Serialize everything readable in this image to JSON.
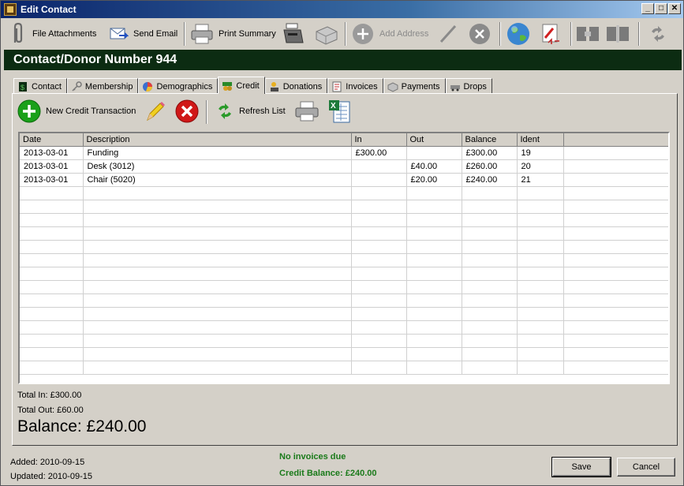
{
  "window": {
    "title": "Edit Contact"
  },
  "toolbar": {
    "file_attachments": "File Attachments",
    "send_email": "Send Email",
    "print_summary": "Print Summary",
    "add_address": "Add Address"
  },
  "banner": {
    "title": "Contact/Donor Number 944"
  },
  "tabs": [
    {
      "label": "Contact",
      "icon": "contact-icon"
    },
    {
      "label": "Membership",
      "icon": "key-icon"
    },
    {
      "label": "Demographics",
      "icon": "pie-chart-icon"
    },
    {
      "label": "Credit",
      "icon": "credit-icon",
      "active": true
    },
    {
      "label": "Donations",
      "icon": "donations-icon"
    },
    {
      "label": "Invoices",
      "icon": "invoice-icon"
    },
    {
      "label": "Payments",
      "icon": "payments-icon"
    },
    {
      "label": "Drops",
      "icon": "drops-icon"
    }
  ],
  "credit_toolbar": {
    "new_transaction": "New Credit Transaction",
    "refresh": "Refresh List"
  },
  "grid": {
    "columns": [
      "Date",
      "Description",
      "In",
      "Out",
      "Balance",
      "Ident"
    ],
    "rows": [
      [
        "2013-03-01",
        "Funding",
        "£300.00",
        "",
        "£300.00",
        "19"
      ],
      [
        "2013-03-01",
        "Desk (3012)",
        "",
        "£40.00",
        "£260.00",
        "20"
      ],
      [
        "2013-03-01",
        "Chair (5020)",
        "",
        "£20.00",
        "£240.00",
        "21"
      ]
    ]
  },
  "totals": {
    "total_in": "Total In: £300.00",
    "total_out": "Total Out: £60.00",
    "balance": "Balance: £240.00"
  },
  "footer": {
    "added": "Added: 2010-09-15",
    "updated": "Updated: 2010-09-15",
    "invoices_status": "No invoices due",
    "credit_balance": "Credit Balance: £240.00",
    "save": "Save",
    "cancel": "Cancel"
  },
  "colors": {
    "banner_bg": "#0c2c12",
    "status_green": "#1a7a1a",
    "accent_add": "#1aa01a",
    "accent_delete": "#d01818"
  }
}
